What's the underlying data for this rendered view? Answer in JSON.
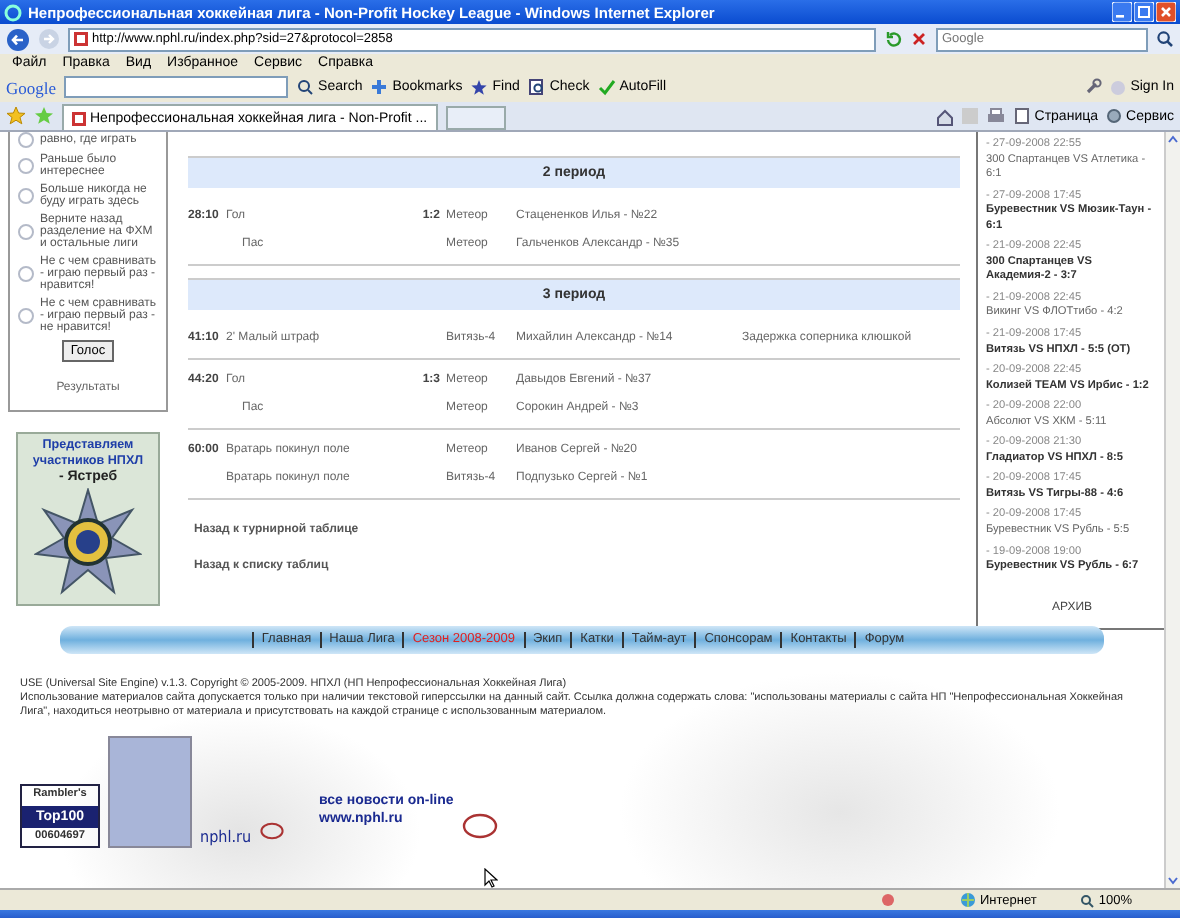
{
  "window": {
    "title": "Непрофессиональная хоккейная лига - Non-Profit Hockey League - Windows Internet Explorer"
  },
  "address_bar": {
    "url": "http://www.nphl.ru/index.php?sid=27&protocol=2858",
    "search_placeholder": "Google"
  },
  "menu": [
    "Файл",
    "Правка",
    "Вид",
    "Избранное",
    "Сервис",
    "Справка"
  ],
  "toolbar": {
    "logo": "Google",
    "items": [
      "Search",
      "Bookmarks",
      "Find",
      "Check",
      "AutoFill"
    ],
    "sign_in": "Sign In"
  },
  "tab": {
    "title": "Непрофессиональная хоккейная лига - Non-Profit ...",
    "tools": [
      "Страница",
      "Сервис"
    ]
  },
  "poll": {
    "options": [
      {
        "text": "равно, где играть",
        "selected": false
      },
      {
        "text": "Раньше было интереснее",
        "selected": false
      },
      {
        "text": "Больше никогда не буду играть здесь",
        "selected": false
      },
      {
        "text": "Верните назад разделение на ФХМ и остальные лиги",
        "selected": false
      },
      {
        "text": "Не с чем сравнивать - играю первый раз - нравится!",
        "selected": false
      },
      {
        "text": "Не с чем сравнивать - играю первый раз - не нравится!",
        "selected": false
      }
    ],
    "vote_button": "Голос",
    "results_link": "Результаты"
  },
  "banner": {
    "title": "Представляем участников НПХЛ",
    "team": "- Ястреб"
  },
  "periods": [
    {
      "title": "2 период",
      "groups": [
        [
          {
            "time": "28:10",
            "event": "Гол",
            "score": "1:2",
            "team": "Метеор",
            "player": "Стацененков Илья - №22"
          },
          {
            "event": "Пас",
            "team": "Метеор",
            "player": "Гальченков Александр - №35"
          }
        ]
      ]
    },
    {
      "title": "3 период",
      "groups": [
        [
          {
            "time": "41:10",
            "event": "2' Малый штраф",
            "team": "Витязь-4",
            "player": "Михайлин Александр - №14",
            "note": "Задержка соперника клюшкой"
          }
        ],
        [
          {
            "time": "44:20",
            "event": "Гол",
            "score": "1:3",
            "team": "Метеор",
            "player": "Давыдов Евгений - №37"
          },
          {
            "event": "Пас",
            "team": "Метеор",
            "player": "Сорокин Андрей - №3"
          }
        ],
        [
          {
            "time": "60:00",
            "event": "Вратарь покинул поле",
            "team": "Метеор",
            "player": "Иванов Сергей - №20"
          },
          {
            "event": "Вратарь покинул поле",
            "team": "Витязь-4",
            "player": "Подпузько Сергей - №1"
          }
        ]
      ]
    }
  ],
  "back_links": [
    "Назад к турнирной таблице",
    "Назад к списку таблиц"
  ],
  "results": {
    "items": [
      {
        "date": "- 27-09-2008 22:55",
        "match": "300 Спартанцев VS Атлетика - 6:1",
        "bold": false
      },
      {
        "date": "- 27-09-2008 17:45",
        "match": "Буревестник VS Мюзик-Таун - 6:1",
        "bold": true
      },
      {
        "date": "- 21-09-2008 22:45",
        "match": "300 Спартанцев VS Академия-2 - 3:7",
        "bold": true
      },
      {
        "date": "- 21-09-2008 22:45",
        "match": "Викинг VS ФЛОТтибо - 4:2",
        "bold": false
      },
      {
        "date": "- 21-09-2008 17:45",
        "match": "Витязь VS НПХЛ - 5:5 (ОТ)",
        "bold": true
      },
      {
        "date": "- 20-09-2008 22:45",
        "match": "Колизей TEAM VS Ирбис - 1:2",
        "bold": true
      },
      {
        "date": "- 20-09-2008 22:00",
        "match": "Абсолют VS ХКМ - 5:11",
        "bold": false
      },
      {
        "date": "- 20-09-2008 21:30",
        "match": "Гладиатор VS НПХЛ - 8:5",
        "bold": true
      },
      {
        "date": "- 20-09-2008 17:45",
        "match": "Витязь VS Тигры-88 - 4:6",
        "bold": true
      },
      {
        "date": "- 20-09-2008 17:45",
        "match": "Буревестник VS Рубль - 5:5",
        "bold": false
      },
      {
        "date": "- 19-09-2008 19:00",
        "match": "Буревестник VS Рубль - 6:7",
        "bold": true
      }
    ],
    "archive": "АРХИВ"
  },
  "nav": {
    "items": [
      {
        "label": "Главная",
        "selected": false
      },
      {
        "label": "Наша Лига",
        "selected": false
      },
      {
        "label": "Сезон 2008-2009",
        "selected": true
      },
      {
        "label": "Экип",
        "selected": false
      },
      {
        "label": "Катки",
        "selected": false
      },
      {
        "label": "Тайм-аут",
        "selected": false
      },
      {
        "label": "Спонсорам",
        "selected": false
      },
      {
        "label": "Контакты",
        "selected": false
      },
      {
        "label": "Форум",
        "selected": false
      }
    ]
  },
  "footer": {
    "copyright": "USE (Universal Site Engine) v.1.3. Copyright © 2005-2009. НПХЛ (НП Непрофессиональная Хоккейная Лига)",
    "notice": "Использование материалов сайта допускается только при наличии текстовой гиперссылки на данный сайт. Ссылка должна содержать слова: \"использованы материалы с сайта НП \"Непрофессиональная Хоккейная Лига\", находиться неотрывно от материала и присутствовать на каждой странице с использованным материалом."
  },
  "badges": {
    "rambler": [
      "Rambler's",
      "Top100",
      "00604697"
    ],
    "site": "nphl.ru",
    "news": "все новости on-line",
    "news_url": "www.nphl.ru"
  },
  "status_bar": {
    "zone": "Интернет",
    "zoom": "100%"
  }
}
